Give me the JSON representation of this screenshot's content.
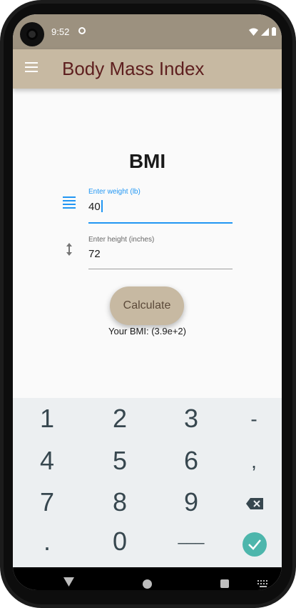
{
  "status_bar": {
    "time": "9:52"
  },
  "app_bar": {
    "title": "Body Mass Index"
  },
  "main": {
    "heading": "BMI",
    "weight_field": {
      "label": "Enter weight (lb)",
      "value": "40"
    },
    "height_field": {
      "label": "Enter height (inches)",
      "value": "72"
    },
    "calculate_label": "Calculate",
    "result_text": "Your BMI: (3.9e+2)"
  },
  "keypad": {
    "row1": [
      "1",
      "2",
      "3",
      "-"
    ],
    "row2": [
      "4",
      "5",
      "6",
      ","
    ],
    "row3": [
      "7",
      "8",
      "9"
    ],
    "row4": [
      ".",
      "0",
      "___"
    ]
  },
  "colors": {
    "app_bar": "#c7b9a2",
    "title": "#5e1f1f",
    "accent": "#2196f3",
    "done_key": "#4db6ac"
  },
  "icons": {
    "menu": "hamburger-menu-icon",
    "weight": "weight-lines-icon",
    "height": "vertical-arrows-icon",
    "backspace": "backspace-icon",
    "done": "check-icon"
  }
}
